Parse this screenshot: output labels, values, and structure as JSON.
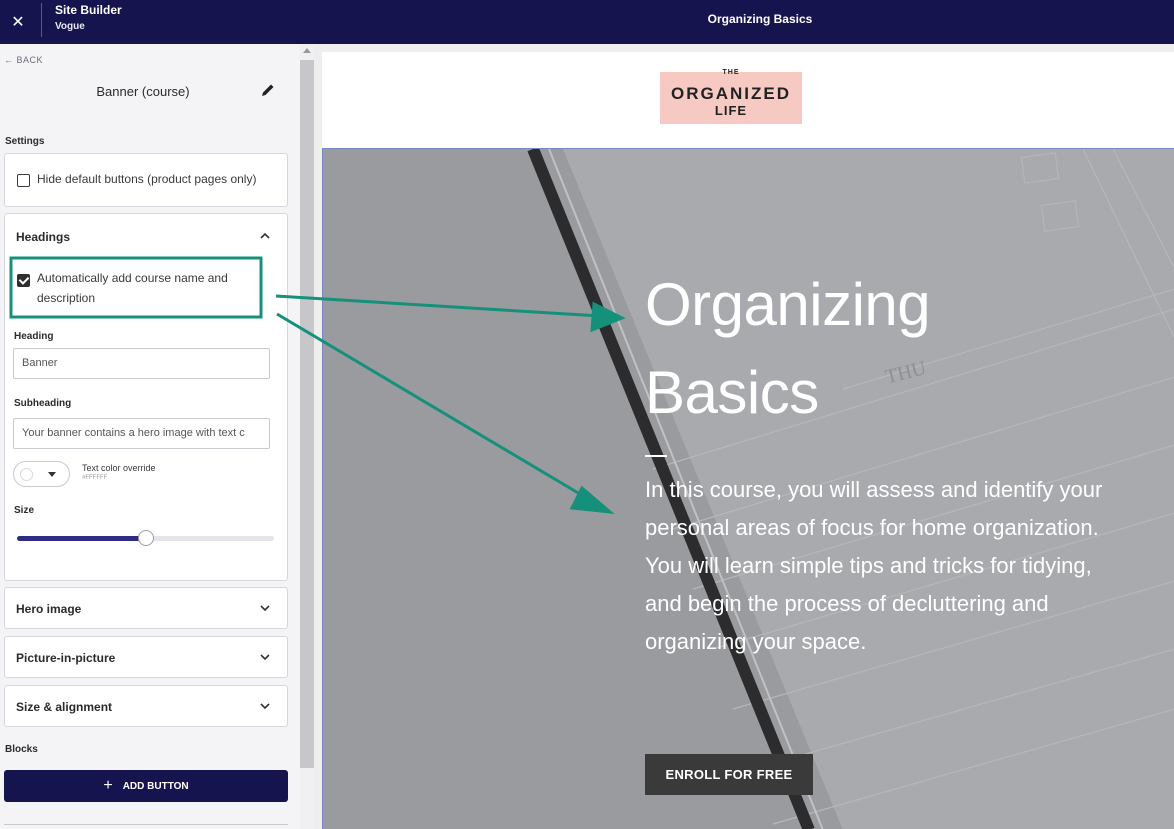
{
  "topbar": {
    "close_icon": "close-icon",
    "app_title": "Site Builder",
    "theme_name": "Vogue",
    "page_title": "Organizing Basics"
  },
  "sidebar": {
    "back_label": "← BACK",
    "panel_title": "Banner (course)",
    "edit_icon": "pencil-icon",
    "settings_label": "Settings",
    "hide_default_buttons": {
      "label": "Hide default buttons (product pages only)",
      "checked": false
    },
    "headings": {
      "title": "Headings",
      "expanded": true,
      "auto_add": {
        "label_line1": "Automatically add course name and",
        "label_line2": "description",
        "checked": true
      },
      "heading_label": "Heading",
      "heading_value": "Banner",
      "subheading_label": "Subheading",
      "subheading_value": "Your banner contains a hero image with text c",
      "text_color_label": "Text color override",
      "text_color_value": "#FFFFFF",
      "size_label": "Size",
      "size_value_fraction": 0.5
    },
    "accordions": [
      {
        "title": "Hero image"
      },
      {
        "title": "Picture-in-picture"
      },
      {
        "title": "Size & alignment"
      }
    ],
    "blocks_label": "Blocks",
    "add_button_label": "ADD BUTTON"
  },
  "preview": {
    "logo": {
      "line1": "THE",
      "line2": "ORGANIZED",
      "line3": "LIFE"
    },
    "hero": {
      "title_line1": "Organizing",
      "title_line2": "Basics",
      "description": "In this course, you will assess and identify your personal areas of focus for home organization. You will learn simple tips and tricks for tidying, and begin the process of decluttering and organizing your space.",
      "enroll_label": "ENROLL FOR FREE",
      "background_word": "THU"
    }
  },
  "colors": {
    "topbar": "#16144f",
    "accent": "#2e2b84",
    "annotation": "#15907a",
    "logo_bg": "#f6c9c3",
    "hero_overlay": "#9fa0a4",
    "enroll_bg": "#3a3a3a"
  }
}
